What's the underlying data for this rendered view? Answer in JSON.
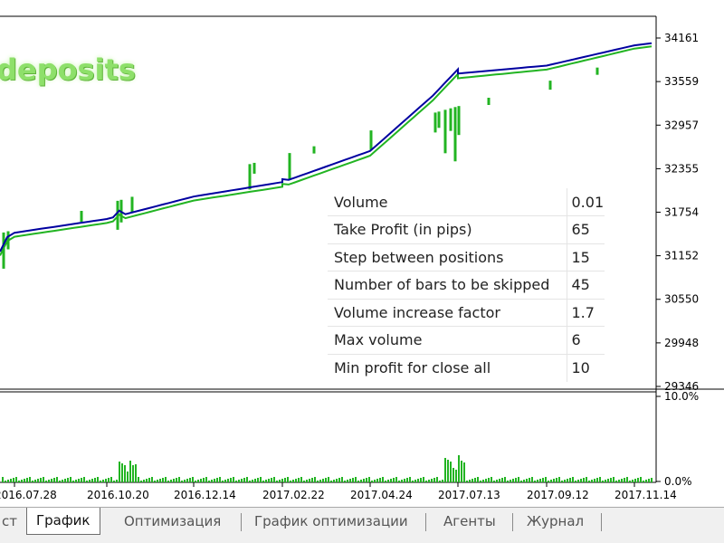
{
  "watermark_text": "deposits",
  "price_axis": {
    "ticks": [
      "34161",
      "33559",
      "32957",
      "32355",
      "31754",
      "31152",
      "30550",
      "29948",
      "29346"
    ]
  },
  "volume_axis": {
    "ticks": [
      "10.0%",
      "0.0%"
    ]
  },
  "date_axis": {
    "ticks": [
      "2016.07.28",
      "2016.10.20",
      "2016.12.14",
      "2017.02.22",
      "2017.04.24",
      "2017.07.13",
      "2017.09.12",
      "2017.11.14"
    ]
  },
  "params": [
    {
      "label": "Volume",
      "value": "0.01"
    },
    {
      "label": "Take Profit (in pips)",
      "value": "65"
    },
    {
      "label": "Step between positions",
      "value": "15"
    },
    {
      "label": "Number of bars to be skipped",
      "value": "45"
    },
    {
      "label": "Volume increase factor",
      "value": "1.7"
    },
    {
      "label": "Max volume",
      "value": "6"
    },
    {
      "label": "Min profit for close all",
      "value": "10"
    }
  ],
  "tabs": [
    {
      "label": "ст",
      "active": false
    },
    {
      "label": "График",
      "active": true
    },
    {
      "label": "Оптимизация",
      "active": false
    },
    {
      "label": "График оптимизации",
      "active": false
    },
    {
      "label": "Агенты",
      "active": false
    },
    {
      "label": "Журнал",
      "active": false
    }
  ],
  "colors": {
    "balance": "#0000a0",
    "equity": "#22b422",
    "deposit_load": "#22b422",
    "grid": "#b0b0b0"
  },
  "chart_data": {
    "type": "line",
    "x": [
      "2016.07.28",
      "2016.10.20",
      "2016.12.14",
      "2017.02.22",
      "2017.04.24",
      "2017.07.13",
      "2017.09.12",
      "2017.11.14"
    ],
    "series": [
      {
        "name": "",
        "values": [
          31470,
          31660,
          31970,
          32170,
          32600,
          33670,
          33780,
          34060
        ]
      },
      {
        "name": "",
        "values": [
          31440,
          31630,
          31940,
          32130,
          32560,
          33630,
          33750,
          34040
        ]
      }
    ],
    "ylim": [
      29346,
      34161
    ],
    "deposit_load_ylim": [
      "0.0%",
      "10.0%"
    ],
    "grid": false,
    "legend": "none"
  }
}
